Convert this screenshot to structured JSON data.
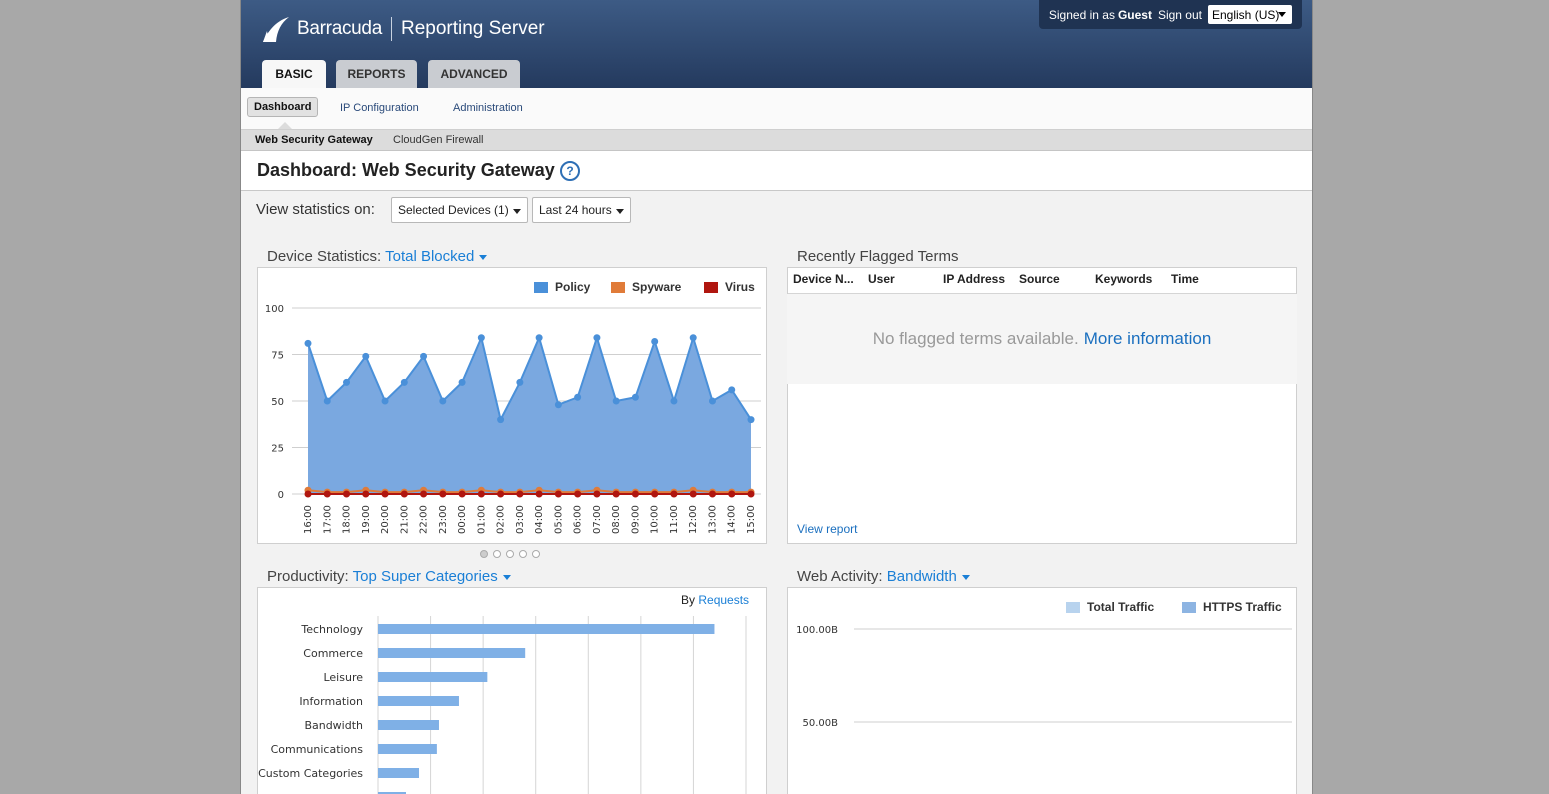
{
  "header": {
    "brand": "Barracuda",
    "product": "Reporting Server",
    "signed_in_label": "Signed in as",
    "user": "Guest",
    "sign_out": "Sign out",
    "language": "English (US)"
  },
  "tabs": [
    {
      "label": "BASIC",
      "active": true
    },
    {
      "label": "REPORTS",
      "active": false
    },
    {
      "label": "ADVANCED",
      "active": false
    }
  ],
  "subnav": [
    {
      "label": "Dashboard",
      "active": true
    },
    {
      "label": "IP Configuration",
      "active": false
    },
    {
      "label": "Administration",
      "active": false
    }
  ],
  "subsubnav": [
    {
      "label": "Web Security Gateway",
      "active": true
    },
    {
      "label": "CloudGen Firewall",
      "active": false
    }
  ],
  "page": {
    "title": "Dashboard: Web Security Gateway",
    "help": "?"
  },
  "filter": {
    "label": "View statistics on:",
    "devices": "Selected Devices (1)",
    "range": "Last 24 hours"
  },
  "device_stats": {
    "title_prefix": "Device Statistics:",
    "title_link": "Total Blocked",
    "legend": [
      {
        "name": "Policy",
        "color": "#4a90d9"
      },
      {
        "name": "Spyware",
        "color": "#e07b39"
      },
      {
        "name": "Virus",
        "color": "#b0160f"
      }
    ]
  },
  "flagged": {
    "title": "Recently Flagged Terms",
    "columns": [
      "Device N...",
      "User",
      "IP Address",
      "Source",
      "Keywords",
      "Time"
    ],
    "empty_text": "No flagged terms available.",
    "more_link": "More information",
    "view_report": "View report"
  },
  "pager": {
    "count": 5,
    "active": 0
  },
  "productivity": {
    "title_prefix": "Productivity:",
    "title_link": "Top Super Categories",
    "by_label": "By",
    "by_link": "Requests"
  },
  "web_activity": {
    "title_prefix": "Web Activity:",
    "title_link": "Bandwidth",
    "legend": [
      {
        "name": "Total Traffic",
        "color": "#b8d3ee"
      },
      {
        "name": "HTTPS Traffic",
        "color": "#8db4e2"
      }
    ]
  },
  "chart_data": [
    {
      "type": "area",
      "title": "Device Statistics: Total Blocked",
      "x": [
        "16:00",
        "17:00",
        "18:00",
        "19:00",
        "20:00",
        "21:00",
        "22:00",
        "23:00",
        "00:00",
        "01:00",
        "02:00",
        "03:00",
        "04:00",
        "05:00",
        "06:00",
        "07:00",
        "08:00",
        "09:00",
        "10:00",
        "11:00",
        "12:00",
        "13:00",
        "14:00",
        "15:00"
      ],
      "ylim": [
        0,
        100
      ],
      "yticks": [
        0,
        25,
        50,
        75,
        100
      ],
      "grid": true,
      "legend": "top-right",
      "series": [
        {
          "name": "Policy",
          "color": "#4a90d9",
          "values": [
            81,
            50,
            60,
            74,
            50,
            60,
            74,
            50,
            60,
            84,
            40,
            60,
            84,
            48,
            52,
            84,
            50,
            52,
            82,
            50,
            84,
            50,
            56,
            40
          ]
        },
        {
          "name": "Spyware",
          "color": "#e07b39",
          "values": [
            2,
            1,
            1,
            2,
            1,
            1,
            2,
            1,
            1,
            2,
            1,
            1,
            2,
            1,
            1,
            2,
            1,
            1,
            1,
            1,
            2,
            1,
            1,
            1
          ]
        },
        {
          "name": "Virus",
          "color": "#b0160f",
          "values": [
            0,
            0,
            0,
            0,
            0,
            0,
            0,
            0,
            0,
            0,
            0,
            0,
            0,
            0,
            0,
            0,
            0,
            0,
            0,
            0,
            0,
            0,
            0,
            0
          ]
        }
      ]
    },
    {
      "type": "bar",
      "title": "Productivity: Top Super Categories",
      "orientation": "horizontal",
      "categories": [
        "Technology",
        "Commerce",
        "Leisure",
        "Information",
        "Bandwidth",
        "Communications",
        "Custom Categories"
      ],
      "values": [
        320,
        140,
        104,
        77,
        58,
        56,
        39
      ],
      "xlim": [
        0,
        350
      ],
      "grid": true,
      "color": "#7fb0e6"
    },
    {
      "type": "line",
      "title": "Web Activity: Bandwidth",
      "yticks": [
        "100.00B",
        "50.00B"
      ],
      "legend": "top-right",
      "series": [
        {
          "name": "Total Traffic",
          "values": []
        },
        {
          "name": "HTTPS Traffic",
          "values": []
        }
      ]
    }
  ]
}
